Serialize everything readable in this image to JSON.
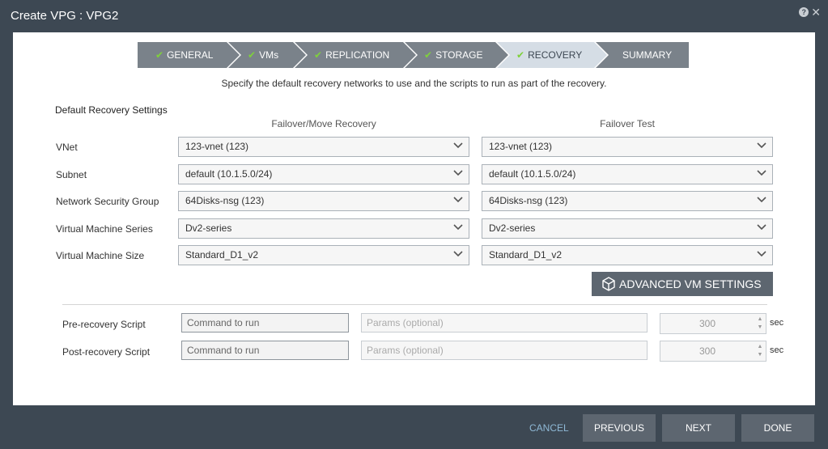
{
  "window": {
    "title": "Create VPG : VPG2",
    "help_icon": "?",
    "close_icon": "✕"
  },
  "wizard": {
    "steps": [
      {
        "label": "GENERAL",
        "done": true
      },
      {
        "label": "VMs",
        "done": true
      },
      {
        "label": "REPLICATION",
        "done": true
      },
      {
        "label": "STORAGE",
        "done": true
      },
      {
        "label": "RECOVERY",
        "done": true,
        "active": true
      },
      {
        "label": "SUMMARY",
        "done": false
      }
    ],
    "check": "✔"
  },
  "instructions": "Specify the default recovery networks to use and the scripts to run as part of the recovery.",
  "settings": {
    "title": "Default Recovery Settings",
    "col_failover": "Failover/Move Recovery",
    "col_test": "Failover Test",
    "rows": [
      {
        "label": "VNet",
        "failover": "123-vnet (123)",
        "test": "123-vnet (123)"
      },
      {
        "label": "Subnet",
        "failover": "default (10.1.5.0/24)",
        "test": "default (10.1.5.0/24)"
      },
      {
        "label": "Network Security Group",
        "failover": "64Disks-nsg (123)",
        "test": "64Disks-nsg (123)"
      },
      {
        "label": "Virtual Machine Series",
        "failover": "Dv2-series",
        "test": "Dv2-series"
      },
      {
        "label": "Virtual Machine Size",
        "failover": "Standard_D1_v2",
        "test": "Standard_D1_v2"
      }
    ]
  },
  "advanced_button": "ADVANCED VM SETTINGS",
  "scripts": {
    "pre": {
      "label": "Pre-recovery Script",
      "command_placeholder": "Command to run",
      "params_placeholder": "Params (optional)",
      "timeout": "300",
      "unit": "sec"
    },
    "post": {
      "label": "Post-recovery Script",
      "command_placeholder": "Command to run",
      "params_placeholder": "Params (optional)",
      "timeout": "300",
      "unit": "sec"
    }
  },
  "footer": {
    "cancel": "CANCEL",
    "previous": "PREVIOUS",
    "next": "NEXT",
    "done": "DONE"
  },
  "colors": {
    "header_bg": "#3d4853",
    "step_bg": "#7a828a",
    "step_active_bg": "#d5dde5",
    "check": "#7fd13b",
    "button_bg": "#5d6670",
    "cancel_link": "#8fb9d6"
  }
}
